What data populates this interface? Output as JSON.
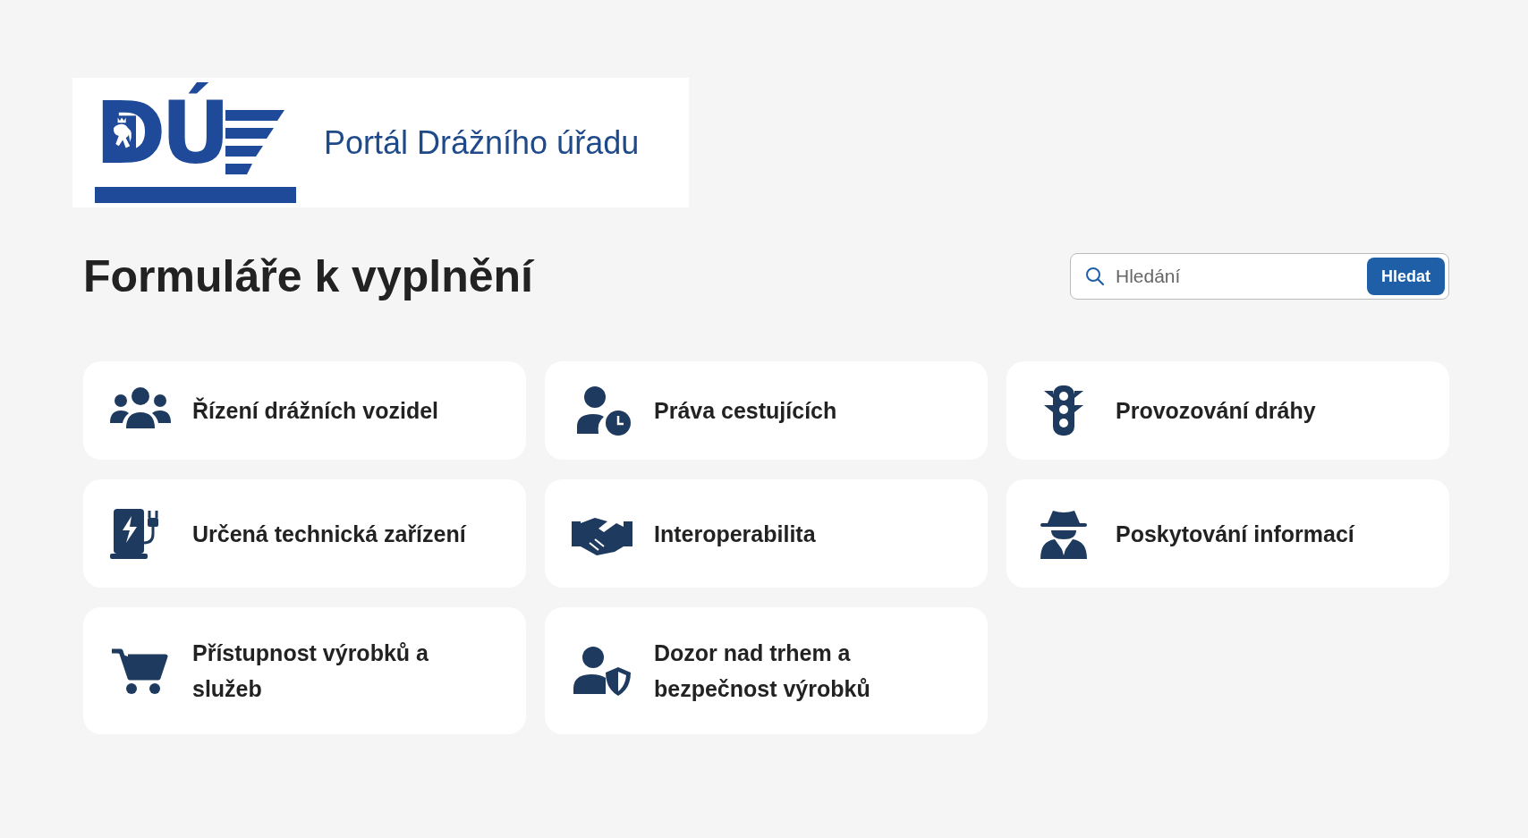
{
  "header": {
    "logo_letters": "DÚ",
    "title": "Portál Drážního úřadu"
  },
  "page_title": "Formuláře k vyplnění",
  "search": {
    "placeholder": "Hledání",
    "button": "Hledat"
  },
  "cards": [
    {
      "label": "Řízení drážních vozidel"
    },
    {
      "label": "Práva cestujících"
    },
    {
      "label": "Provozování dráhy"
    },
    {
      "label": "Určená technická zařízení"
    },
    {
      "label": "Interoperabilita"
    },
    {
      "label": "Poskytování informací"
    },
    {
      "label": "Přístupnost výrobků a služeb"
    },
    {
      "label": "Dozor nad trhem a bezpečnost výrobků"
    }
  ]
}
